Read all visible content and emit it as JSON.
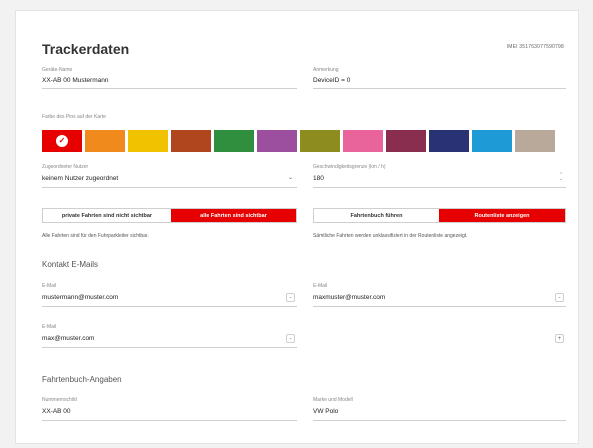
{
  "header": {
    "title": "Trackerdaten",
    "imei": "IMEI 351763077590798"
  },
  "device": {
    "name_label": "Geräte-Name",
    "name_value": "XX-AB 00 Mustermann",
    "note_label": "Anmerkung",
    "note_value": "DeviceID = 0"
  },
  "pin_color": {
    "label": "Farbe des Pins auf der Karte",
    "selected_index": 0,
    "swatches": [
      "#e60000",
      "#f08a1c",
      "#f0c200",
      "#b0461e",
      "#2f8f3e",
      "#9b4f9e",
      "#8c8c1f",
      "#e8649a",
      "#8a2e4f",
      "#2a3276",
      "#1e9bd7",
      "#b8a99a"
    ]
  },
  "assigned_user": {
    "label": "Zugeordneter Nutzer",
    "value": "keinem Nutzer zugeordnet"
  },
  "speed_limit": {
    "label": "Geschwindigkeitsgrenze (km / h)",
    "value": "180"
  },
  "privacy_toggle": {
    "left_label": "private Fahrten sind nicht sichtbar",
    "right_label": "alle Fahrten sind sichtbar",
    "active": "right",
    "help": "Alle Fahrten sind für den Fuhrparkleiter sichtbar."
  },
  "logbook_toggle": {
    "left_label": "Fahrtenbuch führen",
    "right_label": "Routenliste anzeigen",
    "active": "right",
    "help": "Sämtliche Fahrten werden unklassifiziert in der Routenliste angezeigt."
  },
  "contacts": {
    "heading": "Kontakt E-Mails",
    "email_label": "E-Mail",
    "items": [
      {
        "value": "mustermann@muster.com"
      },
      {
        "value": "maxmuster@muster.com"
      },
      {
        "value": "max@muster.com"
      }
    ],
    "remove_symbol": "-",
    "add_symbol": "+"
  },
  "logbook": {
    "heading": "Fahrtenbuch-Angaben",
    "plate_label": "Nummernschild",
    "plate_value": "XX-AB 00",
    "model_label": "Marke und Modell",
    "model_value": "VW Polo"
  },
  "icons": {
    "check": "✓",
    "dropdown": "⌄",
    "spinner_up": "⌃",
    "spinner_down": "⌄"
  },
  "colors": {
    "accent": "#e60000",
    "underline": "#cfcfcf"
  }
}
